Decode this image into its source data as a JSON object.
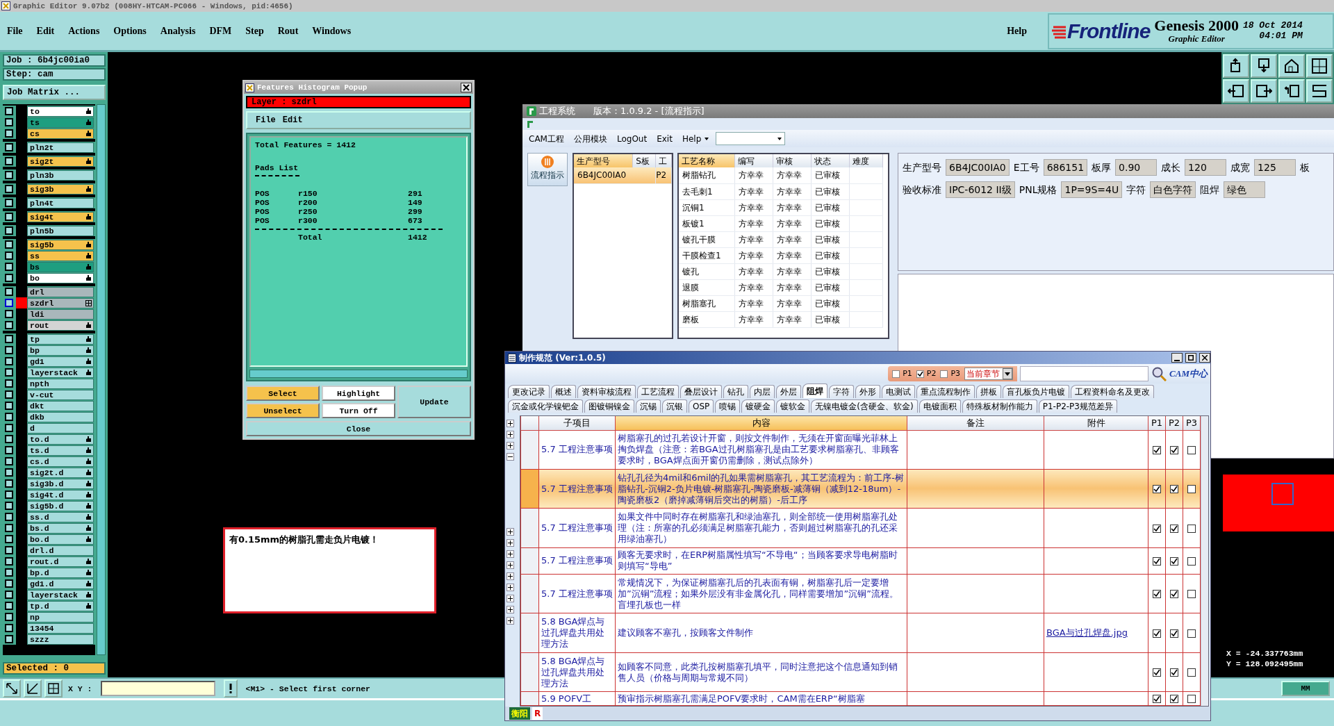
{
  "app_title": "Graphic Editor 9.07b2 (008HY-HTCAM-PC066 - Windows, pid:4656)",
  "menu": [
    "File",
    "Edit",
    "Actions",
    "Options",
    "Analysis",
    "DFM",
    "Step",
    "Rout",
    "Windows"
  ],
  "help": "Help",
  "brand": {
    "logo": "Frontline",
    "product": "Genesis 2000",
    "subtitle": "Graphic Editor",
    "date": "18 Oct 2014",
    "time": "04:01 PM"
  },
  "job": "Job : 6b4jc00ia0",
  "step": "Step: cam",
  "job_matrix": "Job Matrix ...",
  "layer_groups": [
    [
      {
        "name": "to",
        "color": "#ffffff",
        "board": true,
        "work": false
      },
      {
        "name": "ts",
        "color": "#1e9e80",
        "board": true,
        "work": false
      },
      {
        "name": "cs",
        "color": "#f5c24c",
        "board": true,
        "work": false
      }
    ],
    [
      {
        "name": "pln2t",
        "color": "#a6dcdc",
        "board": false,
        "work": false
      }
    ],
    [
      {
        "name": "sig2t",
        "color": "#f5c24c",
        "board": true,
        "work": false
      }
    ],
    [
      {
        "name": "pln3b",
        "color": "#a6dcdc",
        "board": false,
        "work": false
      }
    ],
    [
      {
        "name": "sig3b",
        "color": "#f5c24c",
        "board": true,
        "work": false
      }
    ],
    [
      {
        "name": "pln4t",
        "color": "#a6dcdc",
        "board": false,
        "work": false
      }
    ],
    [
      {
        "name": "sig4t",
        "color": "#f5c24c",
        "board": true,
        "work": false
      }
    ],
    [
      {
        "name": "pln5b",
        "color": "#a6dcdc",
        "board": false,
        "work": false
      }
    ],
    [
      {
        "name": "sig5b",
        "color": "#f5c24c",
        "board": true,
        "work": false
      },
      {
        "name": "ss",
        "color": "#f5c24c",
        "board": true,
        "work": false
      },
      {
        "name": "bs",
        "color": "#1e9e80",
        "board": true,
        "work": false
      },
      {
        "name": "bo",
        "color": "#ffffff",
        "board": true,
        "work": false
      }
    ],
    [
      {
        "name": "drl",
        "color": "#a9b7bb",
        "board": false,
        "work": false
      },
      {
        "name": "szdrl",
        "color": "#a9b7bb",
        "board": false,
        "work": true
      },
      {
        "name": "ldi",
        "color": "#a9b7bb",
        "board": false,
        "work": false
      },
      {
        "name": "rout",
        "color": "#d4d4d4",
        "board": true,
        "work": false
      }
    ],
    [
      {
        "name": "tp",
        "color": "#a6dcdc",
        "board": true,
        "work": false
      },
      {
        "name": "bp",
        "color": "#a6dcdc",
        "board": true,
        "work": false
      },
      {
        "name": "gd1",
        "color": "#a6dcdc",
        "board": true,
        "work": false
      },
      {
        "name": "layerstack",
        "color": "#a6dcdc",
        "board": true,
        "work": false
      },
      {
        "name": "npth",
        "color": "#a6dcdc",
        "board": false,
        "work": false
      },
      {
        "name": "v-cut",
        "color": "#a6dcdc",
        "board": false,
        "work": false
      },
      {
        "name": "dkt",
        "color": "#a6dcdc",
        "board": false,
        "work": false
      },
      {
        "name": "dkb",
        "color": "#a6dcdc",
        "board": false,
        "work": false
      },
      {
        "name": "d",
        "color": "#a6dcdc",
        "board": false,
        "work": false
      },
      {
        "name": "to.d",
        "color": "#a6dcdc",
        "board": true,
        "work": false
      },
      {
        "name": "ts.d",
        "color": "#a6dcdc",
        "board": true,
        "work": false
      },
      {
        "name": "cs.d",
        "color": "#a6dcdc",
        "board": true,
        "work": false
      },
      {
        "name": "sig2t.d",
        "color": "#a6dcdc",
        "board": true,
        "work": false
      },
      {
        "name": "sig3b.d",
        "color": "#a6dcdc",
        "board": true,
        "work": false
      },
      {
        "name": "sig4t.d",
        "color": "#a6dcdc",
        "board": true,
        "work": false
      },
      {
        "name": "sig5b.d",
        "color": "#a6dcdc",
        "board": true,
        "work": false
      },
      {
        "name": "ss.d",
        "color": "#a6dcdc",
        "board": true,
        "work": false
      },
      {
        "name": "bs.d",
        "color": "#a6dcdc",
        "board": true,
        "work": false
      },
      {
        "name": "bo.d",
        "color": "#a6dcdc",
        "board": true,
        "work": false
      },
      {
        "name": "drl.d",
        "color": "#a6dcdc",
        "board": false,
        "work": false
      },
      {
        "name": "rout.d",
        "color": "#a6dcdc",
        "board": true,
        "work": false
      },
      {
        "name": "bp.d",
        "color": "#a6dcdc",
        "board": true,
        "work": false
      },
      {
        "name": "gd1.d",
        "color": "#a6dcdc",
        "board": true,
        "work": false
      },
      {
        "name": "layerstack",
        "color": "#a6dcdc",
        "board": true,
        "work": false
      },
      {
        "name": "tp.d",
        "color": "#a6dcdc",
        "board": true,
        "work": false
      },
      {
        "name": "np",
        "color": "#a6dcdc",
        "board": false,
        "work": false
      },
      {
        "name": "13454",
        "color": "#a6dcdc",
        "board": false,
        "work": false
      },
      {
        "name": "szzz",
        "color": "#a6dcdc",
        "board": false,
        "work": false
      }
    ]
  ],
  "selected_count": "Selected : 0",
  "xy_label": "X Y :",
  "message": "<M1> - Select first corner",
  "coords": [
    "X = -24.337763mm",
    "Y = 128.092495mm"
  ],
  "units": "MM",
  "histogram": {
    "title": "Features Histogram Popup",
    "layer": "Layer :  szdrl",
    "menu": [
      "File",
      "Edit"
    ],
    "total": "Total Features = 1412",
    "list_title": "Pads List",
    "rows": [
      {
        "polarity": "POS",
        "symbol": "r150",
        "count": "291"
      },
      {
        "polarity": "POS",
        "symbol": "r200",
        "count": "149"
      },
      {
        "polarity": "POS",
        "symbol": "r250",
        "count": "299"
      },
      {
        "polarity": "POS",
        "symbol": "r300",
        "count": "673"
      }
    ],
    "total_label": "Total",
    "total_count": "1412",
    "select": "Select",
    "highlight": "Highlight",
    "unselect": "Unselect",
    "turn_off": "Turn Off",
    "update": "Update",
    "close": "Close"
  },
  "note": "有0.15mm的树脂孔需走负片电镀！",
  "eng": {
    "title": "工程系统",
    "version": "版本：1.0.9.2 - [流程指示]",
    "menu": [
      "CAM工程",
      "公用模块",
      "LogOut",
      "Exit",
      "Help"
    ],
    "nav": "流程指示",
    "model_columns": [
      "生产型号",
      "S板",
      "工"
    ],
    "models": [
      {
        "model": "6B4JC00IA0",
        "factory": "P2",
        "selected": true
      }
    ],
    "process_columns": [
      "工艺名称",
      "编写",
      "审核",
      "状态",
      "难度"
    ],
    "processes": [
      [
        "树脂钻孔",
        "方幸幸",
        "方幸幸",
        "已审核"
      ],
      [
        "去毛刺1",
        "方幸幸",
        "方幸幸",
        "已审核"
      ],
      [
        "沉铜1",
        "方幸幸",
        "方幸幸",
        "已审核"
      ],
      [
        "板镀1",
        "方幸幸",
        "方幸幸",
        "已审核"
      ],
      [
        "镀孔干膜",
        "方幸幸",
        "方幸幸",
        "已审核"
      ],
      [
        "干膜检查1",
        "方幸幸",
        "方幸幸",
        "已审核"
      ],
      [
        "镀孔",
        "方幸幸",
        "方幸幸",
        "已审核"
      ],
      [
        "退膜",
        "方幸幸",
        "方幸幸",
        "已审核"
      ],
      [
        "树脂塞孔",
        "方幸幸",
        "方幸幸",
        "已审核"
      ],
      [
        "磨板",
        "方幸幸",
        "方幸幸",
        "已审核"
      ]
    ],
    "info": [
      [
        {
          "label": "生产型号",
          "value": "6B4JC00IA0"
        },
        {
          "label": "E工号",
          "value": "686151"
        },
        {
          "label": "板厚",
          "value": "0.90"
        },
        {
          "label": "成长",
          "value": "120"
        },
        {
          "label": "成宽",
          "value": "125"
        },
        {
          "label": "板"
        }
      ],
      [
        {
          "label": "验收标准",
          "value": "IPC-6012 II级"
        },
        {
          "label": "PNL规格",
          "value": "1P=9S=4U"
        },
        {
          "label": "字符",
          "value": "白色字符"
        },
        {
          "label": "阻焊",
          "value": "绿色"
        }
      ]
    ]
  },
  "spec": {
    "title": "制作规范 (Ver:1.0.5)",
    "filters": [
      {
        "label": "P1",
        "checked": false
      },
      {
        "label": "P2",
        "checked": true
      },
      {
        "label": "P3",
        "checked": false
      }
    ],
    "scope": "当前章节",
    "logo": "CAM中心",
    "tabs": [
      [
        {
          "label": "更改记录",
          "selected": false
        },
        {
          "label": "概述",
          "selected": false
        },
        {
          "label": "资料审核流程",
          "selected": false
        },
        {
          "label": "工艺流程",
          "selected": false
        },
        {
          "label": "叠层设计",
          "selected": false
        },
        {
          "label": "钻孔",
          "selected": false
        },
        {
          "label": "内层",
          "selected": false
        },
        {
          "label": "外层",
          "selected": false
        },
        {
          "label": "阻焊",
          "selected": true
        },
        {
          "label": "字符",
          "selected": false
        },
        {
          "label": "外形",
          "selected": false
        },
        {
          "label": "电测试",
          "selected": false
        },
        {
          "label": "重点流程制作",
          "selected": false
        },
        {
          "label": "拼板",
          "selected": false
        },
        {
          "label": "盲孔板负片电镀",
          "selected": false
        },
        {
          "label": "工程资料命名及更改",
          "selected": false
        }
      ],
      [
        {
          "label": "沉金或化学镍钯金",
          "selected": false
        },
        {
          "label": "图镀铜镍金",
          "selected": false
        },
        {
          "label": "沉锡",
          "selected": false
        },
        {
          "label": "沉银",
          "selected": false
        },
        {
          "label": "OSP",
          "selected": false
        },
        {
          "label": "喷锡",
          "selected": false
        },
        {
          "label": "镀硬金",
          "selected": false
        },
        {
          "label": "镀软金",
          "selected": false
        },
        {
          "label": "无镍电镀金(含硬金、软金)",
          "selected": false
        },
        {
          "label": "电镀面积",
          "selected": false
        },
        {
          "label": "特殊板材制作能力",
          "selected": false
        },
        {
          "label": "P1-P2-P3规范差异",
          "selected": false
        }
      ]
    ],
    "columns": [
      "子项目",
      "内容",
      "备注",
      "附件",
      "P1",
      "P2",
      "P3"
    ],
    "tree_nodes": [
      {
        "expanded": false
      },
      {
        "expanded": false
      },
      {
        "expanded": false
      },
      {
        "expanded": true
      },
      {
        "expanded": false
      },
      {
        "expanded": false
      },
      {
        "expanded": false
      },
      {
        "expanded": false
      },
      {
        "expanded": false
      },
      {
        "expanded": false
      },
      {
        "expanded": false
      },
      {
        "expanded": false
      },
      {
        "expanded": false
      }
    ],
    "rows": [
      {
        "item": "5.7 工程注意事项",
        "content": "树脂塞孔的过孔若设计开窗，则按文件制作，无须在开窗面曝光菲林上掏负焊盘（注意：若BGA过孔树脂塞孔是由工艺要求树脂塞孔、非顾客要求时，BGA焊点面开窗仍需删除，测试点除外）",
        "p1": true,
        "p2": true,
        "p3": false,
        "selected": false
      },
      {
        "item": "5.7 工程注意事项",
        "content": "钻孔孔径为4mil和6mil的孔如果需树脂塞孔，其工艺流程为：前工序-树脂钻孔-沉铜2-负片电镀-树脂塞孔-陶瓷磨板-减薄铜（减到12-18um）-陶瓷磨板2（磨掉减薄铜后突出的树脂）-后工序",
        "p1": true,
        "p2": true,
        "p3": false,
        "selected": true
      },
      {
        "item": "5.7 工程注意事项",
        "content": "如果文件中同时存在树脂塞孔和绿油塞孔，则全部统一使用树脂塞孔处理（注：所塞的孔必须满足树脂塞孔能力，否则超过树脂塞孔的孔还采用绿油塞孔）",
        "p1": true,
        "p2": true,
        "p3": false,
        "selected": false
      },
      {
        "item": "5.7 工程注意事项",
        "content": "顾客无要求时，在ERP树脂属性填写“不导电“；当顾客要求导电树脂时则填写“导电”",
        "p1": true,
        "p2": true,
        "p3": false,
        "selected": false
      },
      {
        "item": "5.7 工程注意事项",
        "content": "常规情况下，为保证树脂塞孔后的孔表面有铜，树脂塞孔后一定要增加”沉铜”流程；如果外层没有非金属化孔，同样需要增加”沉铜”流程。盲埋孔板也一样",
        "p1": true,
        "p2": true,
        "p3": false,
        "selected": false
      },
      {
        "item": "5.8 BGA焊点与过孔焊盘共用处理方法",
        "content": "建议顾客不塞孔，按顾客文件制作",
        "attachment": "BGA与过孔焊盘.jpg",
        "p1": true,
        "p2": true,
        "p3": false,
        "selected": false
      },
      {
        "item": "5.8 BGA焊点与过孔焊盘共用处理方法",
        "content": "如顾客不同意，此类孔按树脂塞孔填平，同时注意把这个信息通知到销售人员（价格与周期与常规不同）",
        "p1": true,
        "p2": true,
        "p3": false,
        "selected": false
      },
      {
        "item": "5.9 POFV工",
        "content": "预审指示树脂塞孔需满足POFV要求时，CAM需在ERP“树脂塞",
        "p1": true,
        "p2": true,
        "p3": false,
        "selected": false
      }
    ],
    "footer": [
      "衡阳",
      "R"
    ]
  }
}
